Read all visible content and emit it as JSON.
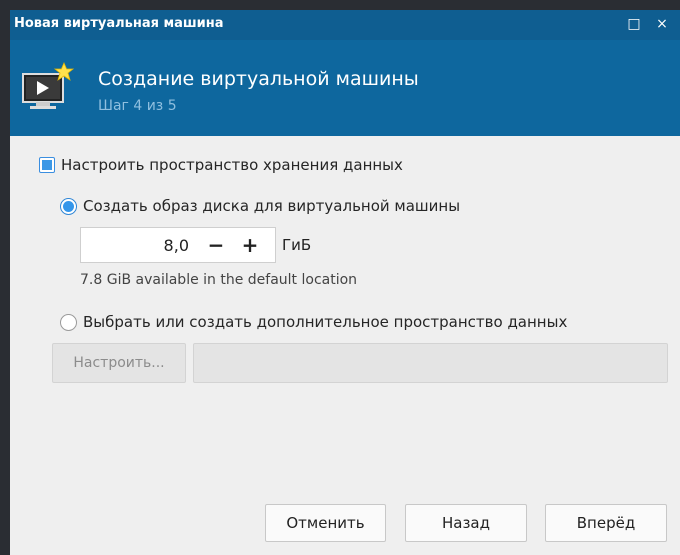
{
  "window": {
    "title": "Новая виртуальная машина",
    "maximize_glyph": "□",
    "close_glyph": "×"
  },
  "header": {
    "title": "Создание виртуальной машины",
    "step": "Шаг 4 из 5",
    "icon": "vm-monitor-new-icon"
  },
  "storage": {
    "enable_label": "Настроить пространство хранения данных",
    "enable_checked": true,
    "create_image_label": "Создать образ диска для виртуальной машины",
    "create_image_selected": true,
    "size_value": "8,0",
    "decrement": "−",
    "increment": "+",
    "size_unit": "ГиБ",
    "available_text": "7.8 GiB available in the default location",
    "select_existing_label": "Выбрать или создать дополнительное пространство данных",
    "select_existing_selected": false,
    "configure_button": "Настроить...",
    "path_value": ""
  },
  "footer": {
    "cancel": "Отменить",
    "back": "Назад",
    "forward": "Вперёд"
  },
  "colors": {
    "titlebar": "#0f5e91",
    "header": "#0e679e",
    "accent": "#3496ea",
    "background": "#efefef"
  }
}
